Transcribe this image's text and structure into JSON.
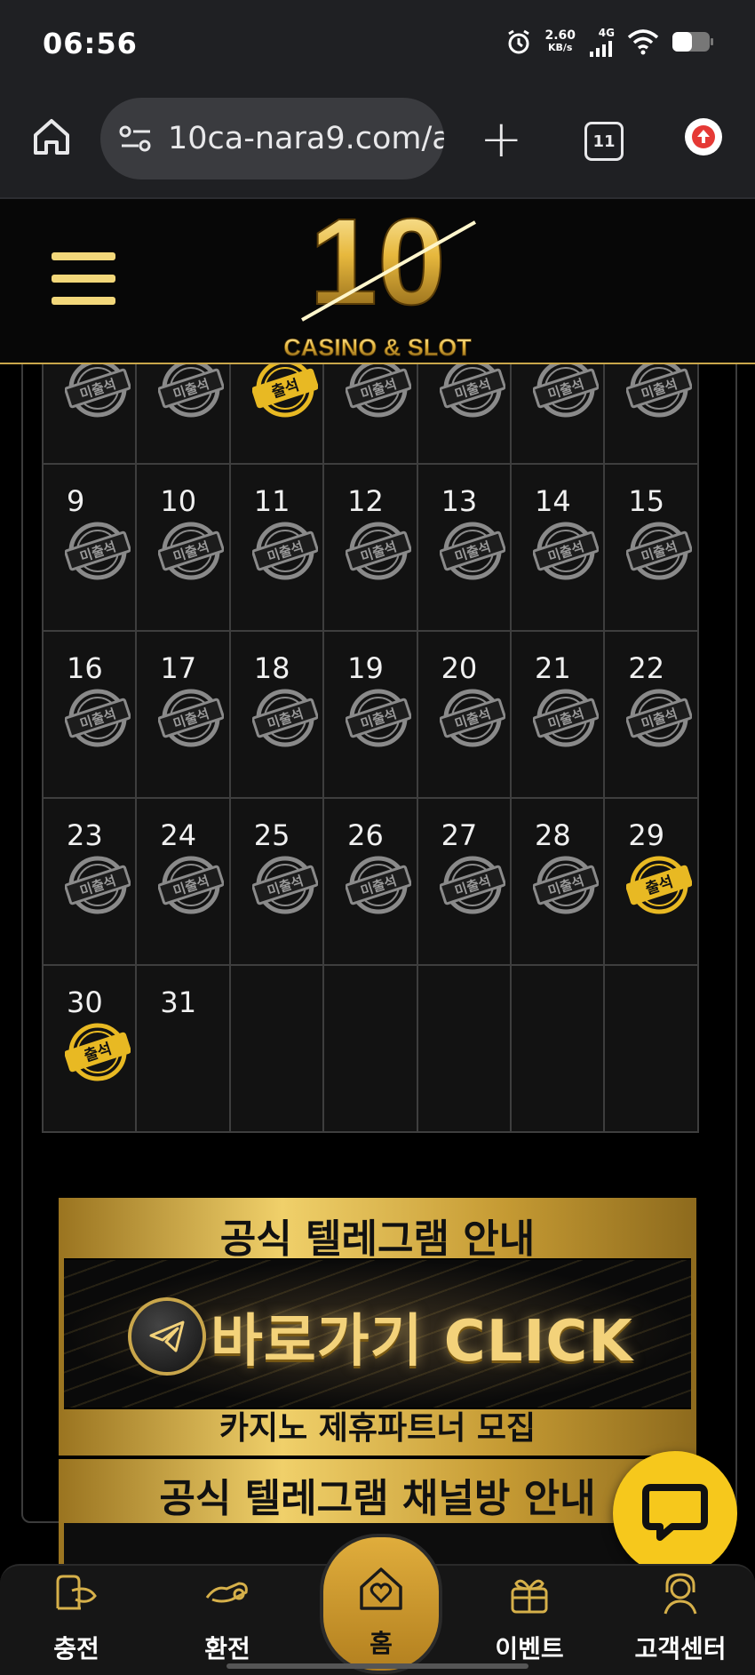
{
  "status_bar": {
    "time": "06:56",
    "net_speed_value": "2.60",
    "net_speed_unit": "KB/s",
    "network_type": "4G",
    "icons": [
      "alarm-icon",
      "signal-icon",
      "wifi-icon",
      "battery-icon"
    ]
  },
  "browser": {
    "url": "10ca-nara9.com/a",
    "tab_count": "11",
    "icons": [
      "home-icon",
      "site-settings-icon",
      "new-tab-icon",
      "tabs-icon",
      "update-icon"
    ]
  },
  "header": {
    "logo_number": "10",
    "logo_text": "CASINO & SLOT",
    "menu_icon": "hamburger-icon"
  },
  "calendar": {
    "stamp_absent": "미출석",
    "stamp_present": "출석",
    "partial_row": [
      {
        "day": "",
        "status": "absent"
      },
      {
        "day": "",
        "status": "absent"
      },
      {
        "day": "",
        "status": "present"
      },
      {
        "day": "",
        "status": "absent"
      },
      {
        "day": "",
        "status": "absent"
      },
      {
        "day": "",
        "status": "absent"
      },
      {
        "day": "",
        "status": "absent"
      }
    ],
    "weeks": [
      [
        {
          "day": "9",
          "status": "absent"
        },
        {
          "day": "10",
          "status": "absent"
        },
        {
          "day": "11",
          "status": "absent"
        },
        {
          "day": "12",
          "status": "absent"
        },
        {
          "day": "13",
          "status": "absent"
        },
        {
          "day": "14",
          "status": "absent"
        },
        {
          "day": "15",
          "status": "absent"
        }
      ],
      [
        {
          "day": "16",
          "status": "absent"
        },
        {
          "day": "17",
          "status": "absent"
        },
        {
          "day": "18",
          "status": "absent"
        },
        {
          "day": "19",
          "status": "absent"
        },
        {
          "day": "20",
          "status": "absent"
        },
        {
          "day": "21",
          "status": "absent"
        },
        {
          "day": "22",
          "status": "absent"
        }
      ],
      [
        {
          "day": "23",
          "status": "absent"
        },
        {
          "day": "24",
          "status": "absent"
        },
        {
          "day": "25",
          "status": "absent"
        },
        {
          "day": "26",
          "status": "absent"
        },
        {
          "day": "27",
          "status": "absent"
        },
        {
          "day": "28",
          "status": "absent"
        },
        {
          "day": "29",
          "status": "present"
        }
      ],
      [
        {
          "day": "30",
          "status": "present"
        },
        {
          "day": "31",
          "status": "none"
        },
        {
          "day": "",
          "status": "none"
        },
        {
          "day": "",
          "status": "none"
        },
        {
          "day": "",
          "status": "none"
        },
        {
          "day": "",
          "status": "none"
        },
        {
          "day": "",
          "status": "none"
        }
      ]
    ]
  },
  "banner1": {
    "title": "공식 텔레그램 안내",
    "cta": "바로가기 CLICK",
    "subtitle": "카지노 제휴파트너 모집"
  },
  "banner2": {
    "title": "공식 텔레그램 채널방 안내"
  },
  "bottom_nav": {
    "items": [
      {
        "label": "충전",
        "icon": "deposit-icon"
      },
      {
        "label": "환전",
        "icon": "withdraw-icon"
      },
      {
        "label": "홈",
        "icon": "home-heart-icon"
      },
      {
        "label": "이벤트",
        "icon": "gift-icon"
      },
      {
        "label": "고객센터",
        "icon": "support-icon"
      }
    ]
  },
  "colors": {
    "gold": "#c9a64b",
    "stamp_present": "#e8b923",
    "stamp_absent": "#8a8a8a",
    "chat_fab": "#f6c81c"
  }
}
